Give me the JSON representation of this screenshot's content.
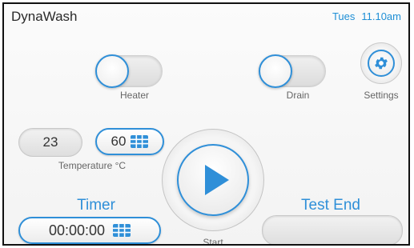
{
  "header": {
    "app_title": "DynaWash",
    "day": "Tues",
    "time": "11.10am"
  },
  "heater": {
    "label": "Heater"
  },
  "drain": {
    "label": "Drain"
  },
  "settings": {
    "label": "Settings",
    "icon": "gear-icon"
  },
  "temperature": {
    "current": "23",
    "setpoint": "60",
    "label": "Temperature °C",
    "icon": "keypad-icon"
  },
  "timer": {
    "title": "Timer",
    "value": "00:00:00",
    "icon": "keypad-icon"
  },
  "start": {
    "label": "Start",
    "icon": "play-icon"
  },
  "test_end": {
    "title": "Test End",
    "value": ""
  },
  "colors": {
    "accent": "#2f8fd8",
    "text": "#333333",
    "label": "#666666"
  }
}
